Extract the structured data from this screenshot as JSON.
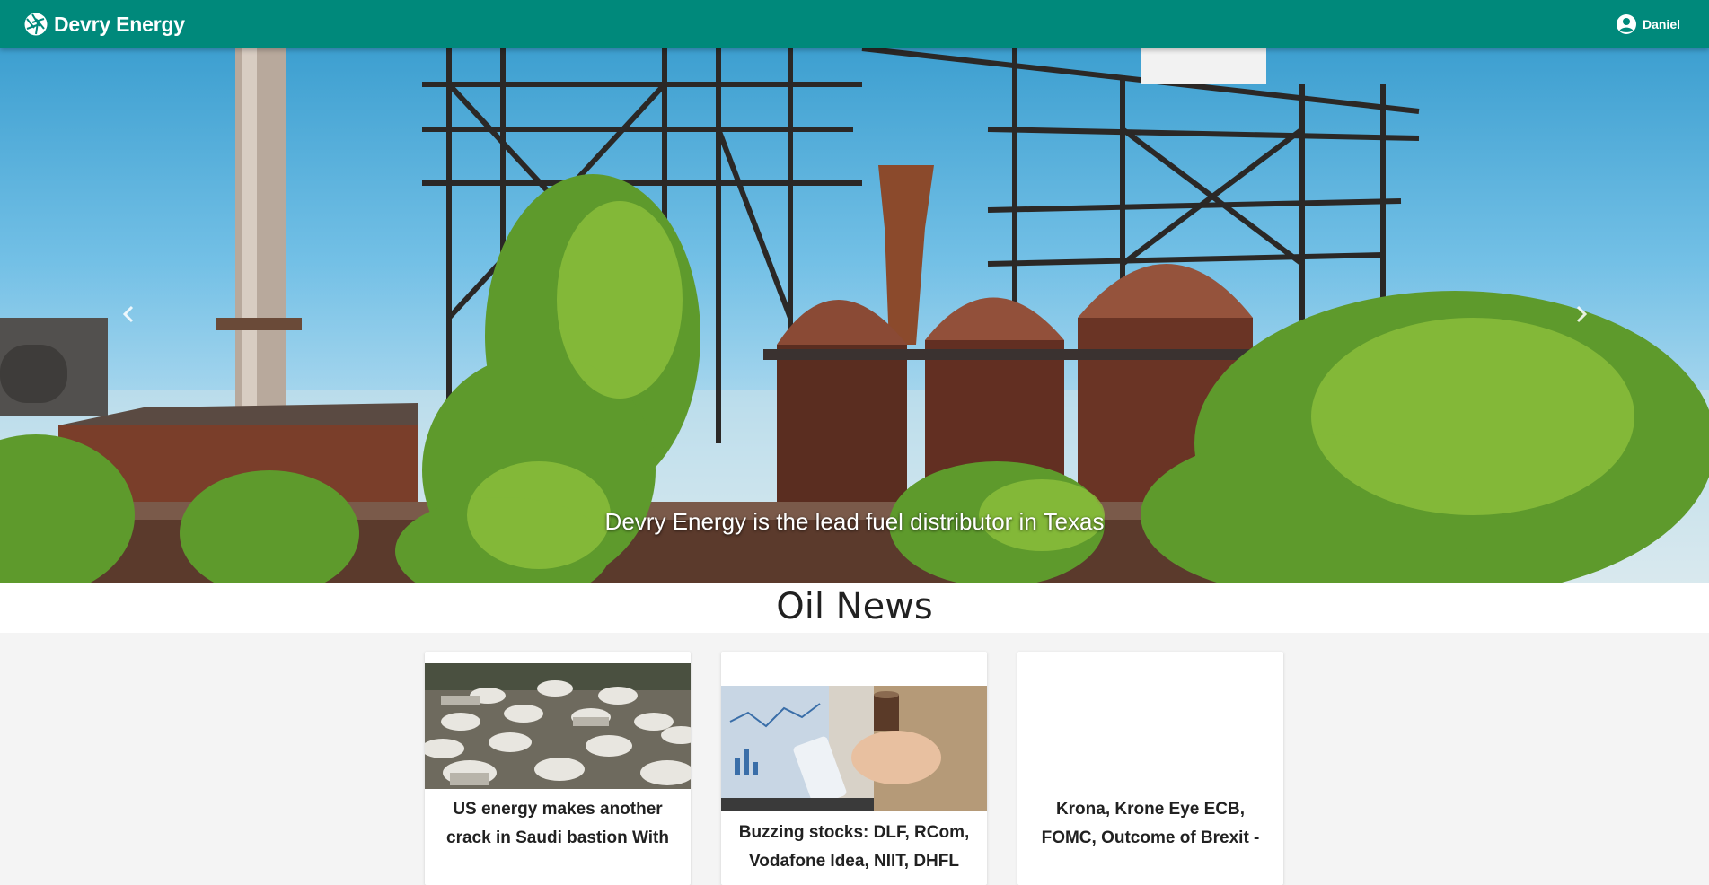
{
  "app": {
    "brand_name": "Devry Energy",
    "brand_icon": "aperture-icon",
    "user_name": "Daniel",
    "user_icon": "account-circle-icon",
    "accent_color": "#00897b"
  },
  "hero": {
    "caption": "Devry Energy is the lead fuel distributor in Texas",
    "prev_icon": "chevron-left-icon",
    "next_icon": "chevron-right-icon"
  },
  "news": {
    "section_title": "Oil News",
    "articles": [
      {
        "title": "US energy makes another crack in Saudi bastion With",
        "image": "oil-storage-tanks-photo"
      },
      {
        "title": "Buzzing stocks: DLF, RCom, Vodafone Idea, NIIT, DHFL",
        "image": "stock-trading-laptop-photo"
      },
      {
        "title": "Krona, Krone Eye ECB, FOMC, Outcome of Brexit -",
        "image": ""
      }
    ]
  }
}
